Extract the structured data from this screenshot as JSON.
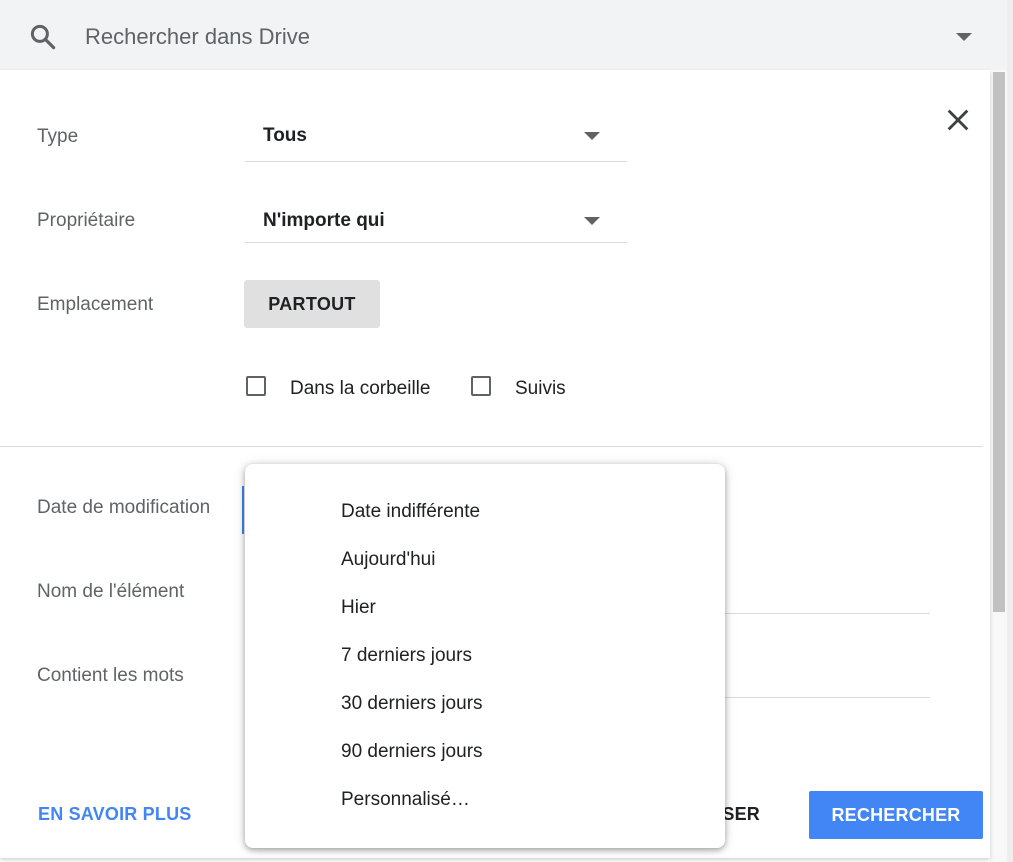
{
  "search": {
    "placeholder": "Rechercher dans Drive"
  },
  "panel": {
    "type": {
      "label": "Type",
      "value": "Tous"
    },
    "owner": {
      "label": "Propriétaire",
      "value": "N'importe qui"
    },
    "location": {
      "label": "Emplacement",
      "value": "PARTOUT"
    },
    "checkboxes": [
      {
        "label": "Dans la corbeille",
        "checked": false
      },
      {
        "label": "Suivis",
        "checked": false
      }
    ],
    "date_modified": {
      "label": "Date de modification"
    },
    "item_name": {
      "label": "Nom de l'élément"
    },
    "contains_words": {
      "label": "Contient les mots"
    }
  },
  "footer": {
    "learn_more": "EN SAVOIR PLUS",
    "reset_partial": "SER",
    "search": "RECHERCHER"
  },
  "date_menu": {
    "items": [
      "Date indifférente",
      "Aujourd'hui",
      "Hier",
      "7 derniers jours",
      "30 derniers jours",
      "90 derniers jours",
      "Personnalisé…"
    ]
  },
  "colors": {
    "accent": "#4285f4",
    "search_bar_bg": "#f1f3f4",
    "button_gray": "#e0e0e0"
  }
}
